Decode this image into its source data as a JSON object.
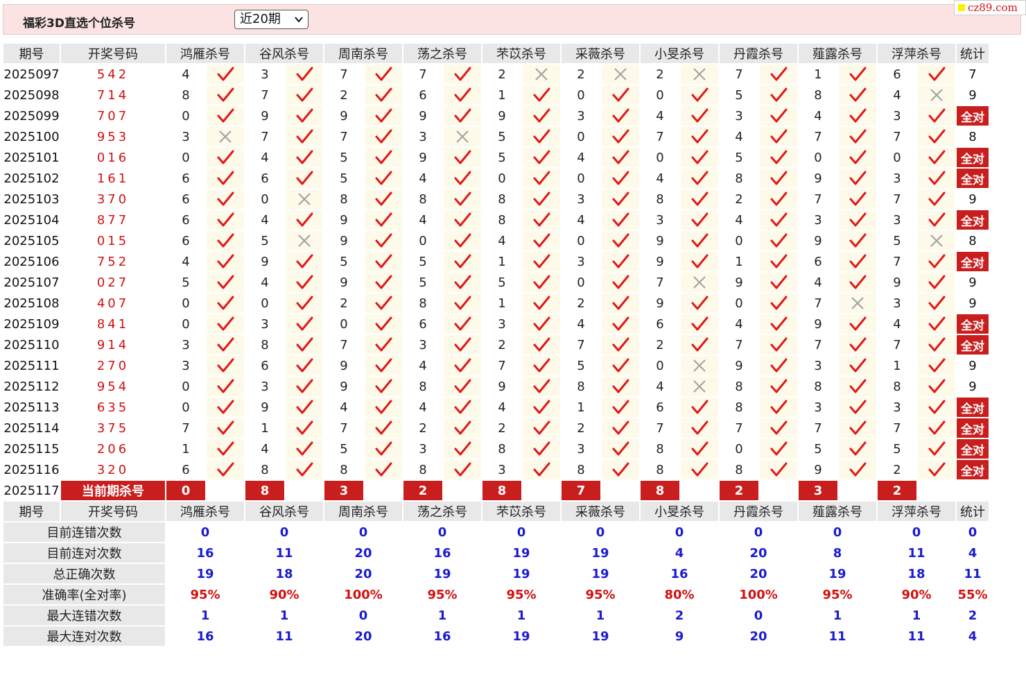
{
  "page": {
    "title": "福彩3D直选个位杀号",
    "period_selected": "近20期",
    "logo_text": "cz89.com"
  },
  "table": {
    "headers": [
      "期号",
      "开奖号码",
      "鸿雁杀号",
      "谷风杀号",
      "周南杀号",
      "荡之杀号",
      "芣苡杀号",
      "采薇杀号",
      "小旻杀号",
      "丹霞杀号",
      "薤露杀号",
      "浮萍杀号",
      "统计"
    ],
    "rows": [
      {
        "issue": "2025097",
        "draw": "542",
        "kills": [
          "4",
          "3",
          "7",
          "7",
          "2",
          "2",
          "2",
          "7",
          "1",
          "6"
        ],
        "ok": [
          1,
          1,
          1,
          1,
          0,
          0,
          0,
          1,
          1,
          1
        ],
        "count": "7",
        "full": false
      },
      {
        "issue": "2025098",
        "draw": "714",
        "kills": [
          "8",
          "7",
          "2",
          "6",
          "1",
          "0",
          "0",
          "5",
          "8",
          "4"
        ],
        "ok": [
          1,
          1,
          1,
          1,
          1,
          1,
          1,
          1,
          1,
          0
        ],
        "count": "9",
        "full": false
      },
      {
        "issue": "2025099",
        "draw": "707",
        "kills": [
          "0",
          "9",
          "9",
          "9",
          "9",
          "3",
          "4",
          "3",
          "4",
          "3"
        ],
        "ok": [
          1,
          1,
          1,
          1,
          1,
          1,
          1,
          1,
          1,
          1
        ],
        "count": "全对",
        "full": true
      },
      {
        "issue": "2025100",
        "draw": "953",
        "kills": [
          "3",
          "7",
          "7",
          "3",
          "5",
          "0",
          "7",
          "4",
          "7",
          "7"
        ],
        "ok": [
          0,
          1,
          1,
          0,
          1,
          1,
          1,
          1,
          1,
          1
        ],
        "count": "8",
        "full": false
      },
      {
        "issue": "2025101",
        "draw": "016",
        "kills": [
          "0",
          "4",
          "5",
          "9",
          "5",
          "4",
          "0",
          "5",
          "0",
          "0"
        ],
        "ok": [
          1,
          1,
          1,
          1,
          1,
          1,
          1,
          1,
          1,
          1
        ],
        "count": "全对",
        "full": true
      },
      {
        "issue": "2025102",
        "draw": "161",
        "kills": [
          "6",
          "6",
          "5",
          "4",
          "0",
          "0",
          "4",
          "8",
          "9",
          "3"
        ],
        "ok": [
          1,
          1,
          1,
          1,
          1,
          1,
          1,
          1,
          1,
          1
        ],
        "count": "全对",
        "full": true
      },
      {
        "issue": "2025103",
        "draw": "370",
        "kills": [
          "6",
          "0",
          "8",
          "8",
          "8",
          "3",
          "8",
          "2",
          "7",
          "7"
        ],
        "ok": [
          1,
          0,
          1,
          1,
          1,
          1,
          1,
          1,
          1,
          1
        ],
        "count": "9",
        "full": false
      },
      {
        "issue": "2025104",
        "draw": "877",
        "kills": [
          "6",
          "4",
          "9",
          "4",
          "8",
          "4",
          "3",
          "4",
          "3",
          "3"
        ],
        "ok": [
          1,
          1,
          1,
          1,
          1,
          1,
          1,
          1,
          1,
          1
        ],
        "count": "全对",
        "full": true
      },
      {
        "issue": "2025105",
        "draw": "015",
        "kills": [
          "6",
          "5",
          "9",
          "0",
          "4",
          "0",
          "9",
          "0",
          "9",
          "5"
        ],
        "ok": [
          1,
          0,
          1,
          1,
          1,
          1,
          1,
          1,
          1,
          0
        ],
        "count": "8",
        "full": false
      },
      {
        "issue": "2025106",
        "draw": "752",
        "kills": [
          "4",
          "9",
          "5",
          "5",
          "1",
          "3",
          "9",
          "1",
          "6",
          "7"
        ],
        "ok": [
          1,
          1,
          1,
          1,
          1,
          1,
          1,
          1,
          1,
          1
        ],
        "count": "全对",
        "full": true
      },
      {
        "issue": "2025107",
        "draw": "027",
        "kills": [
          "5",
          "4",
          "9",
          "5",
          "5",
          "0",
          "7",
          "9",
          "4",
          "9"
        ],
        "ok": [
          1,
          1,
          1,
          1,
          1,
          1,
          0,
          1,
          1,
          1
        ],
        "count": "9",
        "full": false
      },
      {
        "issue": "2025108",
        "draw": "407",
        "kills": [
          "0",
          "0",
          "2",
          "8",
          "1",
          "2",
          "9",
          "0",
          "7",
          "3"
        ],
        "ok": [
          1,
          1,
          1,
          1,
          1,
          1,
          1,
          1,
          0,
          1
        ],
        "count": "9",
        "full": false
      },
      {
        "issue": "2025109",
        "draw": "841",
        "kills": [
          "0",
          "3",
          "0",
          "6",
          "3",
          "4",
          "6",
          "4",
          "9",
          "4"
        ],
        "ok": [
          1,
          1,
          1,
          1,
          1,
          1,
          1,
          1,
          1,
          1
        ],
        "count": "全对",
        "full": true
      },
      {
        "issue": "2025110",
        "draw": "914",
        "kills": [
          "3",
          "8",
          "7",
          "3",
          "2",
          "7",
          "2",
          "7",
          "7",
          "7"
        ],
        "ok": [
          1,
          1,
          1,
          1,
          1,
          1,
          1,
          1,
          1,
          1
        ],
        "count": "全对",
        "full": true
      },
      {
        "issue": "2025111",
        "draw": "270",
        "kills": [
          "3",
          "6",
          "9",
          "4",
          "7",
          "5",
          "0",
          "9",
          "3",
          "1"
        ],
        "ok": [
          1,
          1,
          1,
          1,
          1,
          1,
          0,
          1,
          1,
          1
        ],
        "count": "9",
        "full": false
      },
      {
        "issue": "2025112",
        "draw": "954",
        "kills": [
          "0",
          "3",
          "9",
          "8",
          "9",
          "8",
          "4",
          "8",
          "8",
          "8"
        ],
        "ok": [
          1,
          1,
          1,
          1,
          1,
          1,
          0,
          1,
          1,
          1
        ],
        "count": "9",
        "full": false
      },
      {
        "issue": "2025113",
        "draw": "635",
        "kills": [
          "0",
          "9",
          "4",
          "4",
          "4",
          "1",
          "6",
          "8",
          "3",
          "3"
        ],
        "ok": [
          1,
          1,
          1,
          1,
          1,
          1,
          1,
          1,
          1,
          1
        ],
        "count": "全对",
        "full": true
      },
      {
        "issue": "2025114",
        "draw": "375",
        "kills": [
          "7",
          "1",
          "7",
          "2",
          "2",
          "2",
          "7",
          "7",
          "7",
          "7"
        ],
        "ok": [
          1,
          1,
          1,
          1,
          1,
          1,
          1,
          1,
          1,
          1
        ],
        "count": "全对",
        "full": true
      },
      {
        "issue": "2025115",
        "draw": "206",
        "kills": [
          "1",
          "4",
          "5",
          "3",
          "8",
          "3",
          "8",
          "0",
          "5",
          "5"
        ],
        "ok": [
          1,
          1,
          1,
          1,
          1,
          1,
          1,
          1,
          1,
          1
        ],
        "count": "全对",
        "full": true
      },
      {
        "issue": "2025116",
        "draw": "320",
        "kills": [
          "6",
          "8",
          "8",
          "8",
          "3",
          "8",
          "8",
          "8",
          "9",
          "2"
        ],
        "ok": [
          1,
          1,
          1,
          1,
          1,
          1,
          1,
          1,
          1,
          1
        ],
        "count": "全对",
        "full": true
      }
    ],
    "current": {
      "issue": "2025117",
      "label": "当前期杀号",
      "kills": [
        "0",
        "8",
        "3",
        "2",
        "8",
        "7",
        "8",
        "2",
        "3",
        "2"
      ]
    }
  },
  "stats": [
    {
      "label": "目前连错次数",
      "values": [
        "0",
        "0",
        "0",
        "0",
        "0",
        "0",
        "0",
        "0",
        "0",
        "0"
      ],
      "total": "0",
      "pct": false
    },
    {
      "label": "目前连对次数",
      "values": [
        "16",
        "11",
        "20",
        "16",
        "19",
        "19",
        "4",
        "20",
        "8",
        "11"
      ],
      "total": "4",
      "pct": false
    },
    {
      "label": "总正确次数",
      "values": [
        "19",
        "18",
        "20",
        "19",
        "19",
        "19",
        "16",
        "20",
        "19",
        "18"
      ],
      "total": "11",
      "pct": false
    },
    {
      "label": "准确率(全对率)",
      "values": [
        "95%",
        "90%",
        "100%",
        "95%",
        "95%",
        "95%",
        "80%",
        "100%",
        "95%",
        "90%"
      ],
      "total": "55%",
      "pct": true
    },
    {
      "label": "最大连错次数",
      "values": [
        "1",
        "1",
        "0",
        "1",
        "1",
        "1",
        "2",
        "0",
        "1",
        "1"
      ],
      "total": "2",
      "pct": false
    },
    {
      "label": "最大连对次数",
      "values": [
        "16",
        "11",
        "20",
        "16",
        "19",
        "19",
        "9",
        "20",
        "11",
        "11"
      ],
      "total": "4",
      "pct": false
    }
  ],
  "colors": {
    "accent_red": "#c81e1e",
    "draw_red": "#d01010",
    "stat_blue": "#1a1ad0",
    "result_bg": "#fefaea",
    "header_bg": "#e8e8e8",
    "topbar_bg": "#fbe3e3"
  },
  "icons": {
    "correct": "check-icon",
    "wrong": "cross-icon",
    "dropdown": "chevron-down-icon"
  }
}
